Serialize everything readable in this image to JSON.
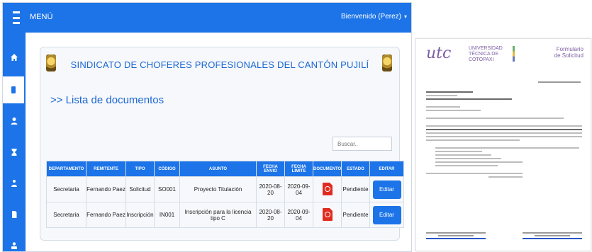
{
  "app": {
    "menu_label": "MENÚ",
    "welcome": "Bienvenido (Perez)",
    "panel_title": "SINDICATO DE CHOFERES PROFESIONALES DEL CANTÓN PUJILÍ",
    "list_title": ">> Lista de documentos",
    "search_placeholder": "Buscar..",
    "sidebar_icons": [
      "home-icon",
      "document-icon",
      "user-icon",
      "hourglass-icon",
      "users-icon",
      "file-icon",
      "profile-icon"
    ],
    "table": {
      "headers": [
        "DEPARTAMENTO",
        "REMITENTE",
        "TIPO",
        "CÓDIGO",
        "ASUNTO",
        "FECHA ENVIO",
        "FECHA LIMITE",
        "DOCUMENTO",
        "ESTADO",
        "EDITAR"
      ],
      "rows": [
        {
          "departamento": "Secretaria",
          "remitente": "Fernando Paez",
          "tipo": "Solicitud",
          "codigo": "SO001",
          "asunto": "Proyecto Titulación",
          "fecha_envio": "2020-08-20",
          "fecha_limite": "2020-09-04",
          "estado": "Pendiente",
          "editar": "Editar"
        },
        {
          "departamento": "Secretaria",
          "remitente": "Fernando Paez",
          "tipo": "Inscripción",
          "codigo": "IN001",
          "asunto": "Inscripción para la licencia tipo C",
          "fecha_envio": "2020-08-20",
          "fecha_limite": "2020-09-04",
          "estado": "Pendiente",
          "editar": "Editar"
        }
      ]
    },
    "colors": {
      "primary": "#1c74e8",
      "title": "#1c67d2",
      "pdf": "#e02b20"
    }
  },
  "document": {
    "logo_text": "utc",
    "university": [
      "UNIVERSIDAD",
      "TÉCNICA DE",
      "COTOPAXI"
    ],
    "form_name": [
      "Formulario",
      "de Solicitud"
    ]
  }
}
